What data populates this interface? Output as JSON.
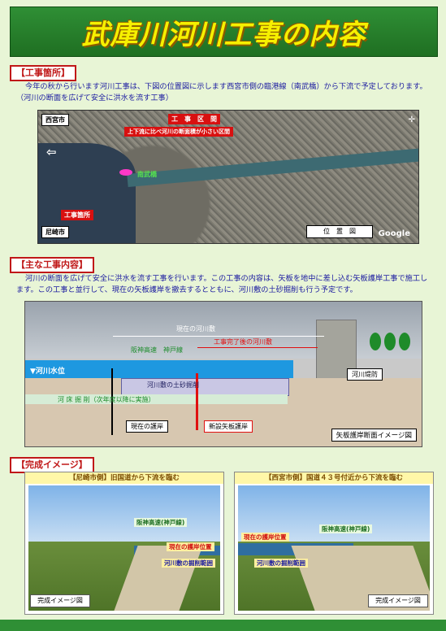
{
  "title": "武庫川河川工事の内容",
  "sections": {
    "location": {
      "label": "【工事箇所】",
      "text": "今年の秋から行います河川工事は、下図の位置図に示します西宮市側の臨港線（南武橋）から下流で予定しております。（河川の断面を広げて安全に洪水を流す工事）",
      "map": {
        "city_nishinomiya": "西宮市",
        "city_amagasaki": "尼崎市",
        "site_label": "工事箇所",
        "section_label": "工　事　区　間",
        "note_label": "上下流に比べ河川の断面積が小さい区間",
        "bridge": "南武橋",
        "legend": "位　置　図",
        "google": "Google"
      }
    },
    "main_work": {
      "label": "【主な工事内容】",
      "text": "河川の断面を広げて安全に洪水を流す工事を行います。この工事の内容は、矢板を地中に差し込む矢板護岸工事で施工します。この工事と並行して、現在の矢板護岸を撤去するとともに、河川敷の土砂掘削も行う予定です。",
      "diagram": {
        "current_river": "現在の河川敷",
        "after_work": "工事完了後の河川敷",
        "hanshin": "阪神高速　神戸線",
        "water_level": "▼河川水位",
        "soil": "河川敷の土砂掘削",
        "dredge": "河 床 掘 削（次年度以降に実施）",
        "current_wall": "現在の護岸",
        "new_wall": "新設矢板護岸",
        "levee": "河川堤防",
        "caption": "矢板護岸断面イメージ図"
      }
    },
    "completion": {
      "label": "【完成イメージ】",
      "photo_left": {
        "caption": "【尼崎市側】旧国道から下流を臨む",
        "tag1": "阪神高速(神戸線)",
        "tag2": "現在の護岸位置",
        "tag3": "河川敷の掘削範囲",
        "badge": "完成イメージ図"
      },
      "photo_right": {
        "caption": "【西宮市側】国道４３号付近から下流を臨む",
        "tag1": "現在の護岸位置",
        "tag2": "阪神高速(神戸線)",
        "tag3": "河川敷の掘削範囲",
        "badge": "完成イメージ図"
      }
    }
  },
  "colors": {
    "title_bg": "#2f8f35",
    "title_text": "#f6f000",
    "label_border": "#c01818",
    "body_text": "#1a1aa0"
  }
}
